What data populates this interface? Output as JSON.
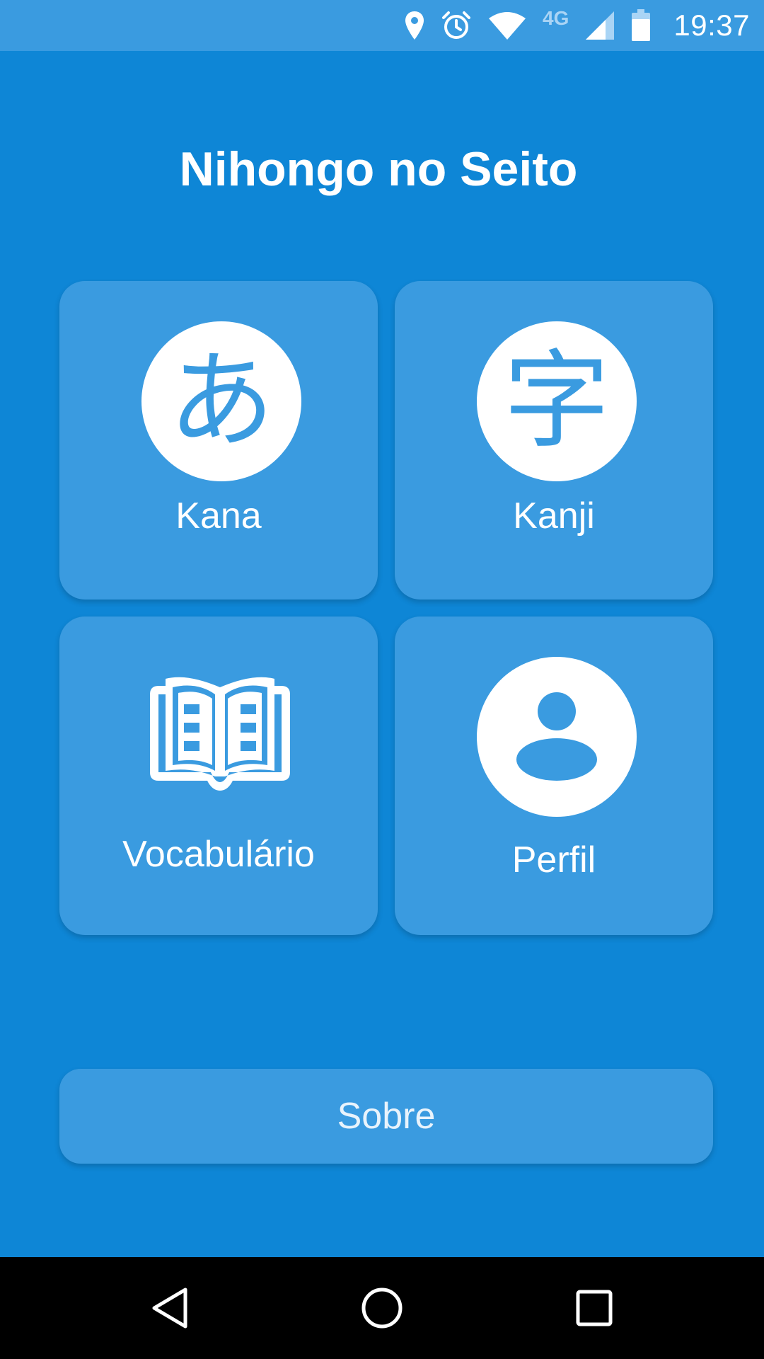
{
  "status_bar": {
    "network_label": "4G",
    "time": "19:37",
    "icons": [
      "location-icon",
      "alarm-icon",
      "wifi-icon",
      "cell-signal-icon",
      "battery-icon"
    ]
  },
  "app": {
    "title": "Nihongo no Seito"
  },
  "tiles": [
    {
      "label": "Kana",
      "icon": "hiragana-a-icon",
      "glyph": "あ"
    },
    {
      "label": "Kanji",
      "icon": "kanji-ji-icon",
      "glyph": "字"
    },
    {
      "label": "Vocabulário",
      "icon": "open-book-icon"
    },
    {
      "label": "Perfil",
      "icon": "profile-icon"
    }
  ],
  "about_button": {
    "label": "Sobre"
  },
  "nav_bar": {
    "icons": [
      "back-icon",
      "home-icon",
      "recents-icon"
    ]
  },
  "colors": {
    "background": "#0e86d6",
    "tile": "#3a9be0",
    "status_bar": "#3a9be0",
    "nav_bar": "#000000",
    "icon_fill": "#ffffff"
  }
}
